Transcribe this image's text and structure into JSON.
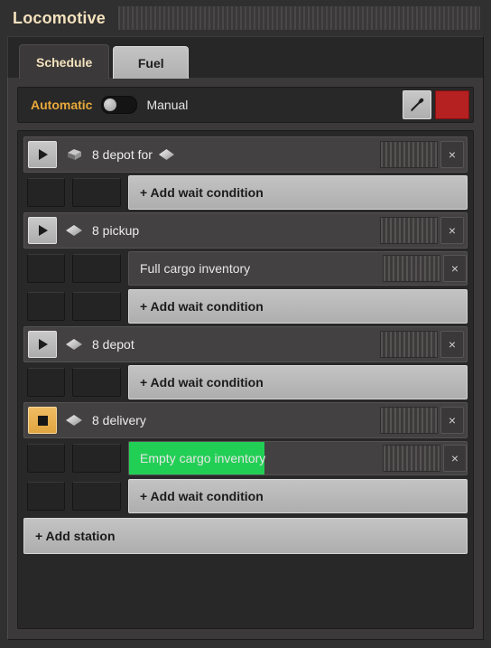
{
  "window": {
    "title": "Locomotive"
  },
  "tabs": [
    {
      "label": "Schedule",
      "active": true
    },
    {
      "label": "Fuel",
      "active": false
    }
  ],
  "mode_bar": {
    "automatic_label": "Automatic",
    "manual_label": "Manual",
    "selected": "Automatic",
    "eyedropper_icon": "eyedropper-icon",
    "color_swatch_hex": "#b52020",
    "automatic_color_hex": "#e9a93a"
  },
  "schedule": {
    "stations": [
      {
        "go_icon": "play-icon",
        "is_current": false,
        "lead_icon": "cargo-item-icon",
        "name": "8 depot for",
        "trailing_icon": "gem-icon",
        "close_label": "×",
        "conditions": [
          {
            "type": "add",
            "label": "+ Add wait condition"
          }
        ]
      },
      {
        "go_icon": "play-icon",
        "is_current": false,
        "lead_icon": "gem-icon",
        "name": "8 pickup",
        "trailing_icon": null,
        "close_label": "×",
        "conditions": [
          {
            "type": "condition",
            "label": "Full cargo inventory",
            "progress_pct": 0,
            "close_label": "×"
          },
          {
            "type": "add",
            "label": "+ Add wait condition"
          }
        ]
      },
      {
        "go_icon": "play-icon",
        "is_current": false,
        "lead_icon": "gem-icon",
        "name": "8 depot",
        "trailing_icon": null,
        "close_label": "×",
        "conditions": [
          {
            "type": "add",
            "label": "+ Add wait condition"
          }
        ]
      },
      {
        "go_icon": "stop-icon",
        "is_current": true,
        "lead_icon": "gem-icon",
        "name": "8 delivery",
        "trailing_icon": null,
        "close_label": "×",
        "conditions": [
          {
            "type": "condition",
            "label": "Empty cargo inventory",
            "progress_pct": 40,
            "close_label": "×"
          },
          {
            "type": "add",
            "label": "+ Add wait condition"
          }
        ]
      }
    ],
    "add_station_label": "+ Add station"
  }
}
